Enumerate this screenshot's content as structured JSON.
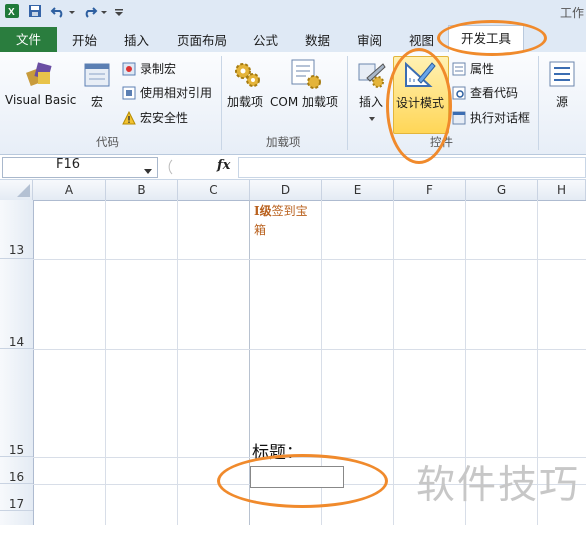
{
  "app": {
    "title_fragment": "工作"
  },
  "ribbon_tabs": [
    "文件",
    "开始",
    "插入",
    "页面布局",
    "公式",
    "数据",
    "审阅",
    "视图",
    "开发工具"
  ],
  "ribbon": {
    "groups": {
      "code": {
        "label": "代码",
        "visual_basic": "Visual Basic",
        "macros": "宏",
        "record_macro": "录制宏",
        "relative_ref": "使用相对引用",
        "macro_security": "宏安全性"
      },
      "addins": {
        "label": "加载项",
        "addins": "加载项",
        "com_addins": "COM 加载项"
      },
      "controls": {
        "label": "控件",
        "insert": "插入",
        "design_mode": "设计模式",
        "properties": "属性",
        "view_code": "查看代码",
        "run_dialog": "执行对话框"
      },
      "xml": {
        "source": "源"
      }
    }
  },
  "formula_bar": {
    "name_box": "F16",
    "fx": "fx",
    "value": ""
  },
  "sheet": {
    "columns": [
      "A",
      "B",
      "C",
      "D",
      "E",
      "F",
      "G",
      "H"
    ],
    "rows": [
      "13",
      "14",
      "15",
      "16",
      "17"
    ],
    "cell_D13_prefix": "I级",
    "cell_D13_text": "签到宝箱",
    "title_label": "标题：",
    "textbox_value": ""
  },
  "watermark": "软件技巧",
  "colors": {
    "file_tab": "#2a7d3e",
    "annotation": "#f08a2c",
    "design_mode_active": "#ffd657"
  }
}
